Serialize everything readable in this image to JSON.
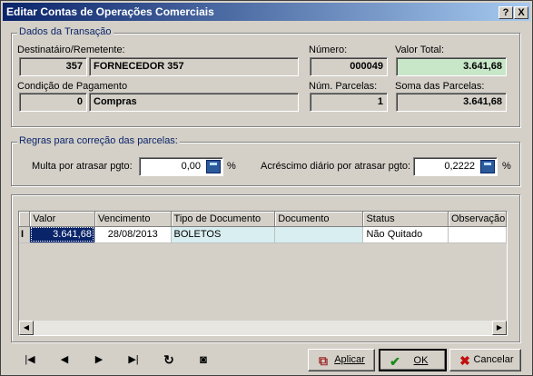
{
  "window": {
    "title": "Editar Contas de Operações Comerciais",
    "help_btn": "?",
    "close_btn": "X"
  },
  "transacao": {
    "legend": "Dados da Transação",
    "dest_label": "Destinatáiro/Remetente:",
    "dest_code": "357",
    "dest_name": "FORNECEDOR 357",
    "numero_label": "Número:",
    "numero": "000049",
    "valor_total_label": "Valor Total:",
    "valor_total": "3.641,68",
    "cond_label": "Condição de Pagamento",
    "cond_code": "0",
    "cond_name": "Compras",
    "num_parcelas_label": "Núm. Parcelas:",
    "num_parcelas": "1",
    "soma_label": "Soma das Parcelas:",
    "soma": "3.641,68"
  },
  "regras": {
    "legend": "Regras para correção das parcelas:",
    "multa_label": "Multa por atrasar pgto:",
    "multa_value": "0,00",
    "multa_unit": "%",
    "acrescimo_label": "Acréscimo diário por atrasar pgto:",
    "acrescimo_value": "0,2222",
    "acrescimo_unit": "%"
  },
  "grid": {
    "columns": [
      "Valor",
      "Vencimento",
      "Tipo de Documento",
      "Documento",
      "Status",
      "Observação"
    ],
    "rows": [
      {
        "indicator": "I",
        "valor": "3.641,68",
        "vencimento": "28/08/2013",
        "tipo": "BOLETOS",
        "documento": "",
        "status": "Não Quitado",
        "obs": ""
      }
    ]
  },
  "nav": {
    "first": "|◀",
    "prev": "◀",
    "next": "▶",
    "last": "▶|",
    "refresh": "↻",
    "cancel_edit": "◙"
  },
  "buttons": {
    "aplicar": "Aplicar",
    "ok": "OK",
    "cancelar": "Cancelar"
  }
}
